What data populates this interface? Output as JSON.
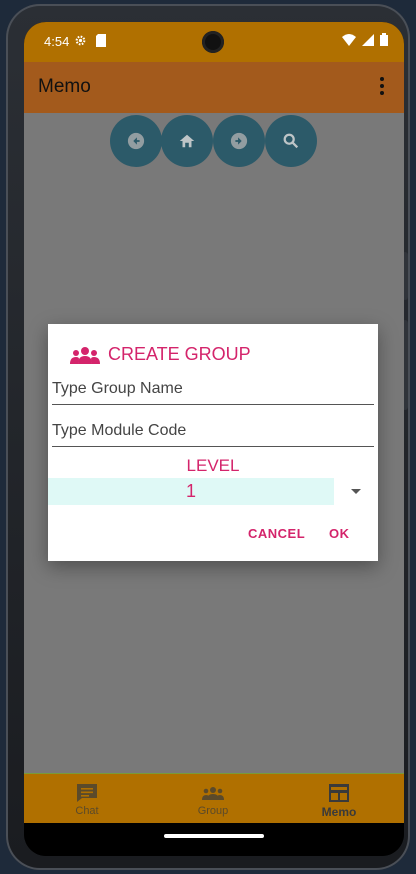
{
  "status": {
    "time": "4:54"
  },
  "app_bar": {
    "title": "Memo"
  },
  "dialog": {
    "title": "CREATE GROUP",
    "group_name_placeholder": "Type Group Name",
    "module_code_placeholder": "Type Module Code",
    "level_label": "LEVEL",
    "level_value": "1",
    "cancel_label": "CANCEL",
    "ok_label": "OK"
  },
  "bottom_nav": {
    "items": [
      {
        "label": "Chat",
        "icon": "chat-icon"
      },
      {
        "label": "Group",
        "icon": "group-icon"
      },
      {
        "label": "Memo",
        "icon": "memo-icon",
        "active": true
      }
    ]
  },
  "colors": {
    "accent": "#d4246b",
    "status_bar": "#b07000",
    "app_bar": "#a35a1c",
    "nav_button": "#2f5f6f"
  }
}
